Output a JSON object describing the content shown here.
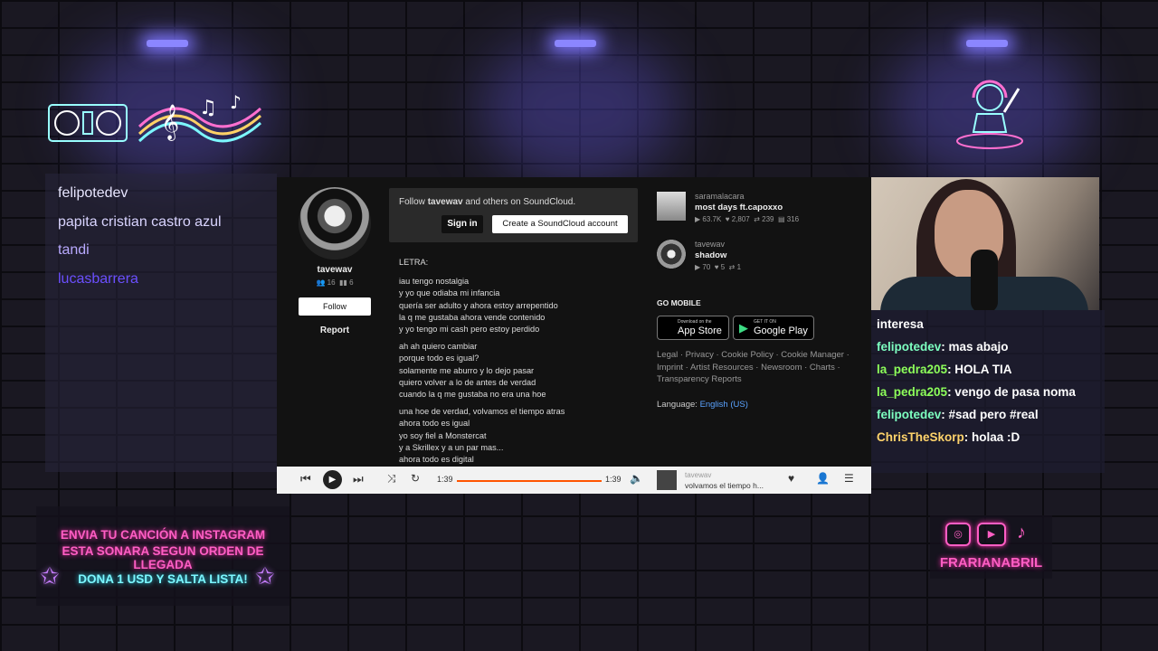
{
  "viewers": [
    "felipotedev",
    "papita cristian castro azul",
    "tandi",
    "lucasbarrera"
  ],
  "viewer_colors": [
    "#e8e6ff",
    "#d9d4ff",
    "#b9aaff",
    "#6b4fff"
  ],
  "soundcloud": {
    "profile": {
      "username": "tavewav",
      "followers": "16",
      "tracks": "6",
      "follow_label": "Follow",
      "report_label": "Report"
    },
    "follow_prompt": {
      "prefix": "Follow ",
      "user": "tavewav",
      "suffix": " and others on SoundCloud.",
      "signin_label": "Sign in",
      "create_label": "Create a SoundCloud account"
    },
    "lyrics": {
      "heading": "LETRA:",
      "stanzas": [
        [
          "iau tengo nostalgia",
          "y yo que odiaba mi infancia",
          "quería ser adulto y ahora estoy arrepentido",
          "la q me gustaba ahora vende contenido",
          "y yo tengo mi cash pero estoy perdido"
        ],
        [
          "ah ah quiero cambiar",
          "porque todo es igual?",
          "solamente me aburro y lo dejo pasar",
          "quiero volver a lo de antes de verdad",
          "cuando la q me gustaba no era una hoe"
        ],
        [
          "una hoe de verdad, volvamos el tiempo atras",
          "ahora todo es igual",
          "yo soy fiel a Monstercat",
          "y a Skrillex y a un par mas...",
          "ahora todo es digital"
        ]
      ]
    },
    "related": [
      {
        "artist": "saramalacara",
        "title": "most days ft.capoxxo",
        "plays": "63.7K",
        "likes": "2,807",
        "reposts": "239",
        "comments": "316"
      },
      {
        "artist": "tavewav",
        "title": "shadow",
        "plays": "70",
        "likes": "5",
        "reposts": "1"
      }
    ],
    "go_mobile": "GO MOBILE",
    "app_store": {
      "small": "Download on the",
      "large": "App Store"
    },
    "google_play": {
      "small": "GET IT ON",
      "large": "Google Play"
    },
    "legal_links": "Legal · Privacy · Cookie Policy · Cookie Manager · Imprint · Artist Resources · Newsroom · Charts · Transparency Reports",
    "language_label": "Language:",
    "language_value": "English (US)",
    "player": {
      "elapsed": "1:39",
      "duration": "1:39",
      "progress": 1.0,
      "artist": "tavewav",
      "title": "volvamos el tiempo h..."
    }
  },
  "chat": {
    "partial": "interesa",
    "messages": [
      {
        "user": "felipotedev",
        "text": ": mas abajo",
        "color": "#7dffc0"
      },
      {
        "user": "la_pedra205",
        "text": ": HOLA TIA",
        "color": "#8dff5a"
      },
      {
        "user": "la_pedra205",
        "text": ": vengo de pasa noma",
        "color": "#8dff5a"
      },
      {
        "user": "felipotedev",
        "text": ": #sad pero #real",
        "color": "#7dffc0"
      },
      {
        "user": "ChrisTheSkorp",
        "text": ": holaa :D",
        "color": "#ffd36b"
      }
    ]
  },
  "promo": {
    "line1": "ENVIA TU CANCIÓN A INSTAGRAM",
    "line2": "ESTA SONARA SEGUN ORDEN DE LLEGADA",
    "line3": "DONA 1 USD Y SALTA LISTA!"
  },
  "socials": {
    "handle": "FRARIANABRIL",
    "icons": [
      "instagram-icon",
      "youtube-icon",
      "tiktok-icon"
    ]
  },
  "colors": {
    "accent_pink": "#ff5ec4",
    "accent_cyan": "#7cf7ff",
    "soundcloud_orange": "#ff5500",
    "link_blue": "#5aa3ff"
  }
}
